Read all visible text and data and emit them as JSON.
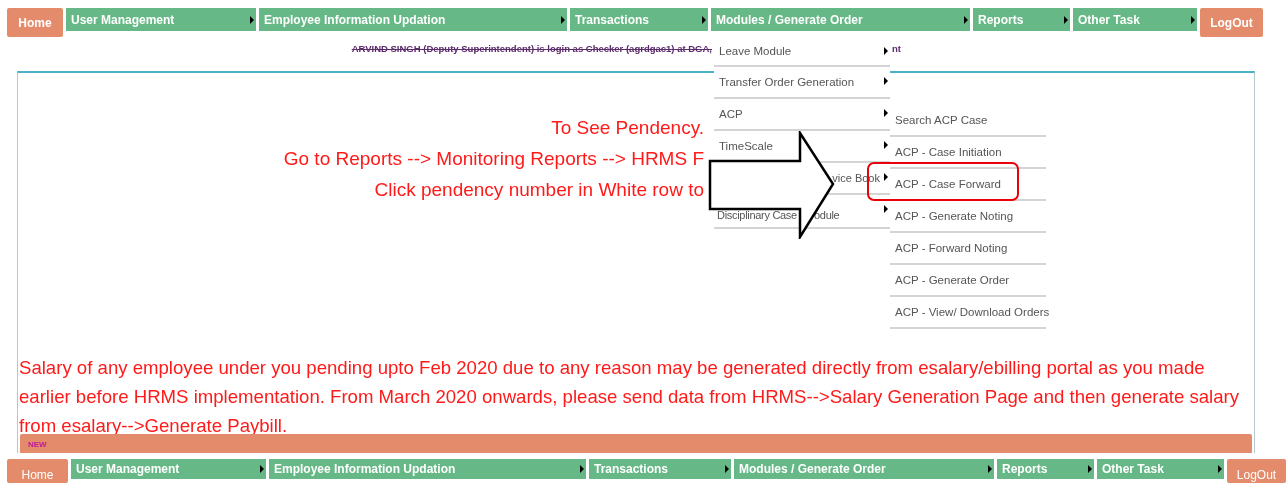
{
  "top_nav": [
    {
      "label": "Home",
      "kind": "home"
    },
    {
      "label": "User Management",
      "kind": "menu"
    },
    {
      "label": "Employee Information Updation",
      "kind": "menu"
    },
    {
      "label": "Transactions",
      "kind": "menu"
    },
    {
      "label": "Modules / Generate Order",
      "kind": "menu"
    },
    {
      "label": "Reports",
      "kind": "menu"
    },
    {
      "label": "Other Task",
      "kind": "menu"
    },
    {
      "label": "LogOut",
      "kind": "logout"
    }
  ],
  "login_line": {
    "before": "ARVIND SINGH (Deputy Superintendent) is login as Checker (agrdgac1) at DGA,",
    "after": "nt"
  },
  "modules_menu": [
    {
      "label": "Leave Module",
      "clipped": false
    },
    {
      "label": "Transfer Order Generation",
      "clipped": false
    },
    {
      "label": "ACP",
      "clipped": false
    },
    {
      "label": "TimeScale",
      "clipped": false
    },
    {
      "label": "vice Book",
      "clipped": true
    },
    {
      "label": "Disciplinary Case",
      "clipped": false,
      "label_after_arrow": "odule"
    }
  ],
  "acp_submenu": [
    {
      "label": "Search ACP Case",
      "highlighted": false
    },
    {
      "label": "ACP - Case Initiation",
      "highlighted": false
    },
    {
      "label": "ACP - Case Forward",
      "highlighted": true
    },
    {
      "label": "ACP - Generate Noting",
      "highlighted": false
    },
    {
      "label": "ACP - Forward Noting",
      "highlighted": false
    },
    {
      "label": "ACP - Generate Order",
      "highlighted": false
    },
    {
      "label": "ACP - View/ Download Orders",
      "highlighted": false
    }
  ],
  "pendency_lines": [
    "To See Pendency.",
    "Go to Reports --> Monitoring Reports --> HRMS F",
    "Click pendency number in White row to"
  ],
  "salary_notice": "Salary of any employee under you pending upto Feb 2020 due to any reason may be generated directly from esalary/ebilling portal as you made earlier before HRMS implementation. From March 2020 onwards, please send data from HRMS-->Salary Generation Page and then generate salary from esalary-->Generate Paybill.",
  "news_bar": {
    "badge": "NEW"
  },
  "bottom_nav": [
    {
      "label": "Home",
      "kind": "home"
    },
    {
      "label": "User Management",
      "kind": "menu"
    },
    {
      "label": "Employee Information Updation",
      "kind": "menu"
    },
    {
      "label": "Transactions",
      "kind": "menu"
    },
    {
      "label": "Modules / Generate Order",
      "kind": "menu"
    },
    {
      "label": "Reports",
      "kind": "menu"
    },
    {
      "label": "Other Task",
      "kind": "menu"
    },
    {
      "label": "LogOut",
      "kind": "logout"
    }
  ]
}
